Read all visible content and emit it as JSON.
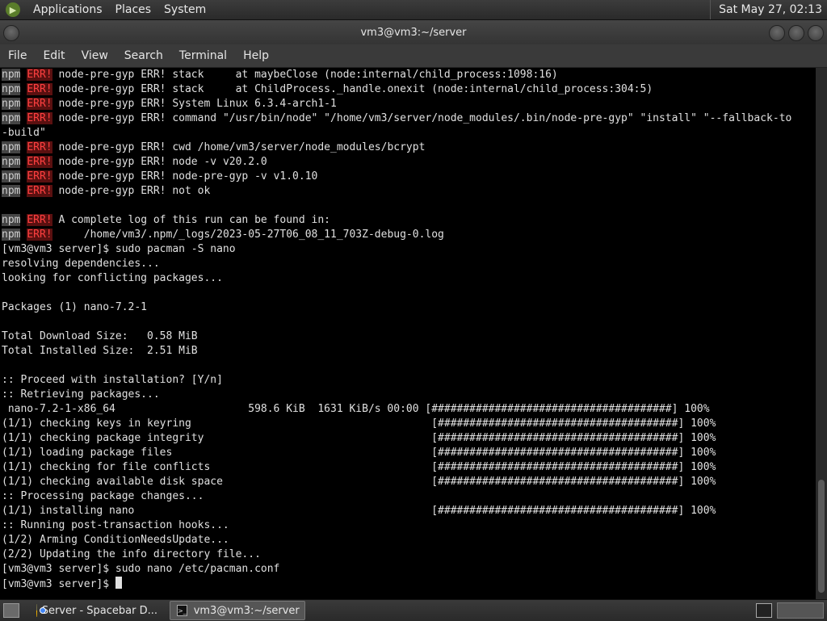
{
  "top_panel": {
    "menus": [
      "Applications",
      "Places",
      "System"
    ],
    "clock": "Sat May 27, 02:13"
  },
  "window": {
    "title": "vm3@vm3:~/server"
  },
  "menubar": [
    "File",
    "Edit",
    "View",
    "Search",
    "Terminal",
    "Help"
  ],
  "terminal": {
    "lines": [
      {
        "npm": "npm",
        "err": "ERR!",
        "text": " node-pre-gyp ERR! stack     at maybeClose (node:internal/child_process:1098:16)"
      },
      {
        "npm": "npm",
        "err": "ERR!",
        "text": " node-pre-gyp ERR! stack     at ChildProcess._handle.onexit (node:internal/child_process:304:5)"
      },
      {
        "npm": "npm",
        "err": "ERR!",
        "text": " node-pre-gyp ERR! System Linux 6.3.4-arch1-1"
      },
      {
        "npm": "npm",
        "err": "ERR!",
        "text": " node-pre-gyp ERR! command \"/usr/bin/node\" \"/home/vm3/server/node_modules/.bin/node-pre-gyp\" \"install\" \"--fallback-to"
      },
      {
        "text": "-build\""
      },
      {
        "npm": "npm",
        "err": "ERR!",
        "text": " node-pre-gyp ERR! cwd /home/vm3/server/node_modules/bcrypt"
      },
      {
        "npm": "npm",
        "err": "ERR!",
        "text": " node-pre-gyp ERR! node -v v20.2.0"
      },
      {
        "npm": "npm",
        "err": "ERR!",
        "text": " node-pre-gyp ERR! node-pre-gyp -v v1.0.10"
      },
      {
        "npm": "npm",
        "err": "ERR!",
        "text": " node-pre-gyp ERR! not ok"
      },
      {
        "text": ""
      },
      {
        "npm": "npm",
        "err": "ERR!",
        "text": " A complete log of this run can be found in:"
      },
      {
        "npm": "npm",
        "err": "ERR!",
        "text": "     /home/vm3/.npm/_logs/2023-05-27T06_08_11_703Z-debug-0.log"
      },
      {
        "text": "[vm3@vm3 server]$ sudo pacman -S nano"
      },
      {
        "text": "resolving dependencies..."
      },
      {
        "text": "looking for conflicting packages..."
      },
      {
        "text": ""
      },
      {
        "text": "Packages (1) nano-7.2-1"
      },
      {
        "text": ""
      },
      {
        "text": "Total Download Size:   0.58 MiB"
      },
      {
        "text": "Total Installed Size:  2.51 MiB"
      },
      {
        "text": ""
      },
      {
        "text": ":: Proceed with installation? [Y/n]"
      },
      {
        "text": ":: Retrieving packages..."
      },
      {
        "text": " nano-7.2-1-x86_64                     598.6 KiB  1631 KiB/s 00:00 [######################################] 100%"
      },
      {
        "text": "(1/1) checking keys in keyring                                      [######################################] 100%"
      },
      {
        "text": "(1/1) checking package integrity                                    [######################################] 100%"
      },
      {
        "text": "(1/1) loading package files                                         [######################################] 100%"
      },
      {
        "text": "(1/1) checking for file conflicts                                   [######################################] 100%"
      },
      {
        "text": "(1/1) checking available disk space                                 [######################################] 100%"
      },
      {
        "text": ":: Processing package changes..."
      },
      {
        "text": "(1/1) installing nano                                               [######################################] 100%"
      },
      {
        "text": ":: Running post-transaction hooks..."
      },
      {
        "text": "(1/2) Arming ConditionNeedsUpdate..."
      },
      {
        "text": "(2/2) Updating the info directory file..."
      },
      {
        "text": "[vm3@vm3 server]$ sudo nano /etc/pacman.conf"
      },
      {
        "text": "[vm3@vm3 server]$ ",
        "cursor": true
      }
    ]
  },
  "taskbar": {
    "tasks": [
      {
        "label": "Server - Spacebar D...",
        "icon": "chrome-icon",
        "active": false
      },
      {
        "label": "vm3@vm3:~/server",
        "icon": "terminal-icon",
        "active": true
      }
    ]
  },
  "colors": {
    "terminal_bg": "#000000",
    "terminal_fg": "#e0e0e0",
    "npm_tag_bg": "#444444",
    "err_tag_fg": "#ff4040"
  }
}
